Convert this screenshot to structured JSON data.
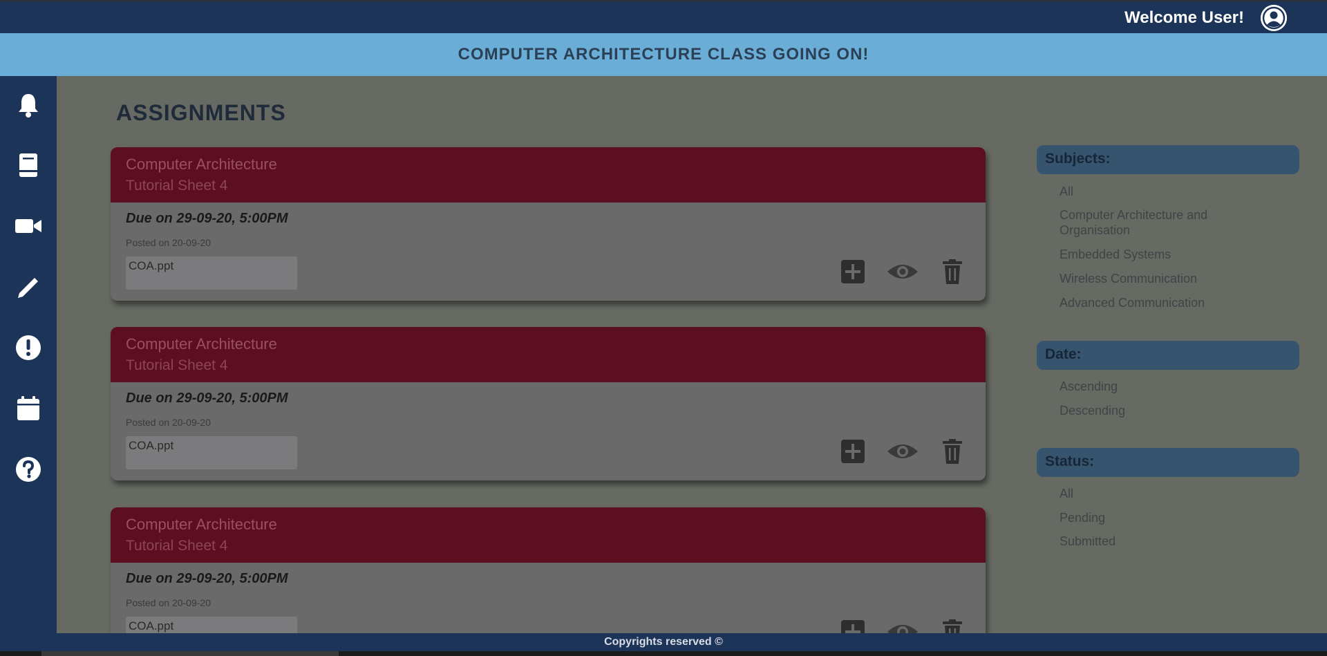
{
  "header": {
    "welcome": "Welcome User!"
  },
  "banner": {
    "text": "COMPUTER ARCHITECTURE CLASS GOING ON!"
  },
  "sidebar": {
    "items": [
      {
        "icon": "bell-icon"
      },
      {
        "icon": "book-icon"
      },
      {
        "icon": "video-icon"
      },
      {
        "icon": "pencil-icon"
      },
      {
        "icon": "alert-icon"
      },
      {
        "icon": "calendar-icon"
      },
      {
        "icon": "help-icon"
      }
    ]
  },
  "main": {
    "title": "ASSIGNMENTS",
    "cards": [
      {
        "subject": "Computer Architecture",
        "sheet": "Tutorial Sheet 4",
        "due": "Due on 29-09-20, 5:00PM",
        "posted": "Posted on 20-09-20",
        "attachment": "COA.ppt"
      },
      {
        "subject": "Computer Architecture",
        "sheet": "Tutorial Sheet 4",
        "due": "Due on 29-09-20, 5:00PM",
        "posted": "Posted on 20-09-20",
        "attachment": "COA.ppt"
      },
      {
        "subject": "Computer Architecture",
        "sheet": "Tutorial Sheet 4",
        "due": "Due on 29-09-20, 5:00PM",
        "posted": "Posted on 20-09-20",
        "attachment": "COA.ppt"
      }
    ]
  },
  "filters": {
    "subjects": {
      "label": "Subjects:",
      "options": [
        "All",
        "Computer Architecture and Organisation",
        "Embedded Systems",
        "Wireless Communication",
        "Advanced Communication"
      ]
    },
    "date": {
      "label": "Date:",
      "options": [
        "Ascending",
        "Descending"
      ]
    },
    "status": {
      "label": "Status:",
      "options": [
        "All",
        "Pending",
        "Submitted"
      ]
    }
  },
  "footer": {
    "text": "Copyrights reserved ©"
  },
  "colors": {
    "navy": "#1d3459",
    "banner": "#6aaed8",
    "card_header": "#5c0f20",
    "background": "#666a62"
  }
}
